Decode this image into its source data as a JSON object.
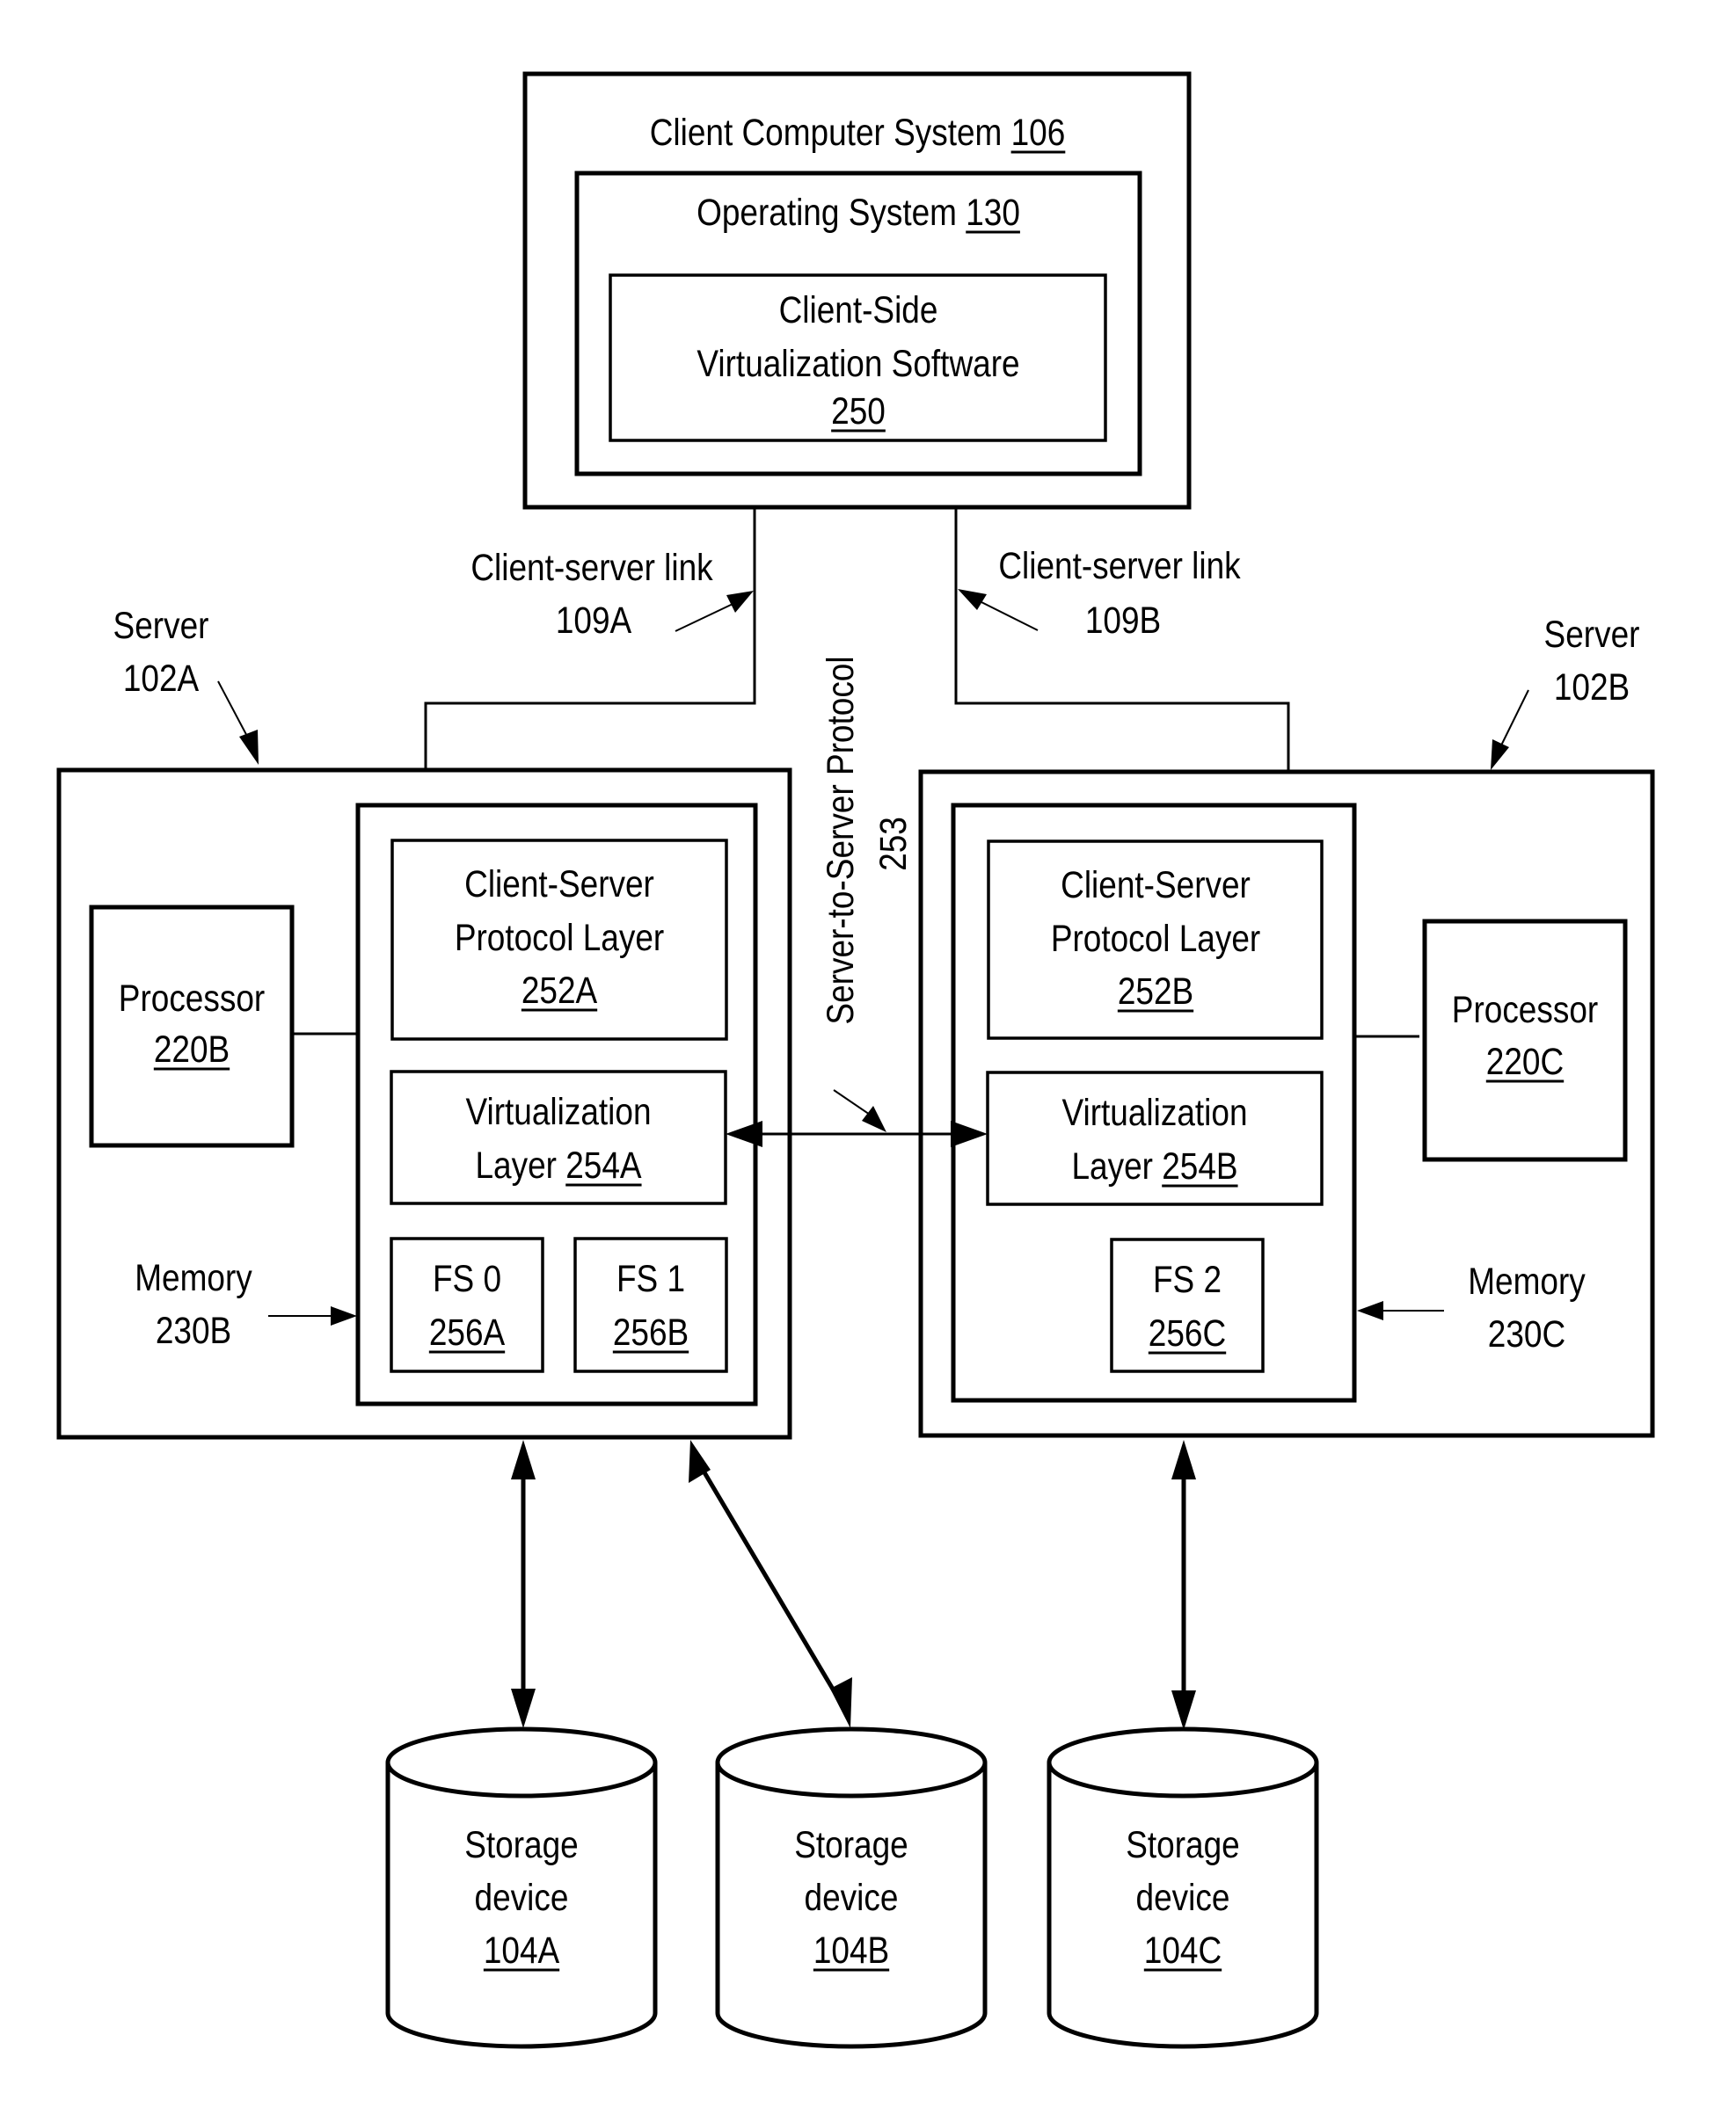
{
  "diagram": {
    "client_system": {
      "label": "Client Computer System",
      "ref": "106",
      "os": {
        "label": "Operating System",
        "ref": "130"
      },
      "software": {
        "lines": [
          "Client-Side",
          "Virtualization Software"
        ],
        "ref": "250"
      }
    },
    "links": {
      "a": {
        "label": "Client-server link",
        "ref": "109A"
      },
      "b": {
        "label": "Client-server link",
        "ref": "109B"
      },
      "server_protocol": {
        "label": "Server-to-Server Protocol",
        "ref": "253"
      }
    },
    "servers": {
      "a": {
        "label": "Server",
        "ref": "102A",
        "processor": {
          "label": "Processor",
          "ref": "220B"
        },
        "memory": {
          "label": "Memory",
          "ref": "230B"
        },
        "protocol_layer": {
          "lines": [
            "Client-Server",
            "Protocol Layer"
          ],
          "ref": "252A"
        },
        "virtualization_layer": {
          "line1": "Virtualization",
          "line2": "Layer",
          "ref": "254A"
        },
        "file_systems": [
          {
            "label": "FS 0",
            "ref": "256A"
          },
          {
            "label": "FS 1",
            "ref": "256B"
          }
        ]
      },
      "b": {
        "label": "Server",
        "ref": "102B",
        "processor": {
          "label": "Processor",
          "ref": "220C"
        },
        "memory": {
          "label": "Memory",
          "ref": "230C"
        },
        "protocol_layer": {
          "lines": [
            "Client-Server",
            "Protocol Layer"
          ],
          "ref": "252B"
        },
        "virtualization_layer": {
          "line1": "Virtualization",
          "line2": "Layer",
          "ref": "254B"
        },
        "file_systems": [
          {
            "label": "FS 2",
            "ref": "256C"
          }
        ]
      }
    },
    "storage": [
      {
        "lines": [
          "Storage",
          "device"
        ],
        "ref": "104A"
      },
      {
        "lines": [
          "Storage",
          "device"
        ],
        "ref": "104B"
      },
      {
        "lines": [
          "Storage",
          "device"
        ],
        "ref": "104C"
      }
    ]
  }
}
